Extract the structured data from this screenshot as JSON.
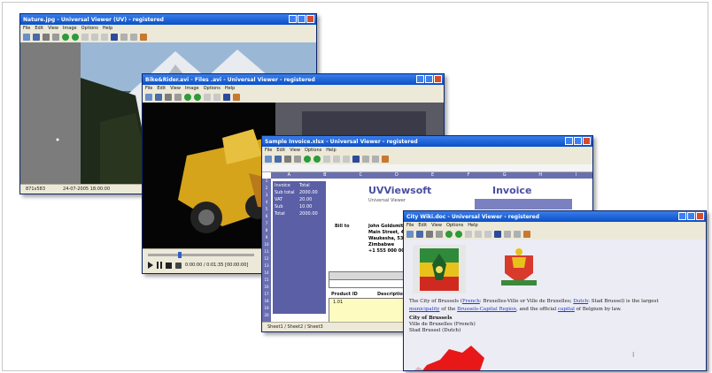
{
  "win1": {
    "title": "Nature.jpg - Universal Viewer (UV) - registered",
    "menu": [
      "File",
      "Edit",
      "View",
      "Image",
      "Options",
      "Help"
    ],
    "status": [
      "871x583",
      "24-07-2005 18:00:00"
    ]
  },
  "win2": {
    "title": "Bike&Rider.avi - Files .avi - Universal Viewer - registered",
    "menu": [
      "File",
      "Edit",
      "View",
      "Image",
      "Options",
      "Help"
    ],
    "status": "0:00:00 / 0:01:35 [00:00:00]"
  },
  "win3": {
    "title": "Sample Invoice.xlsx - Universal Viewer - registered",
    "menu": [
      "File",
      "Edit",
      "View",
      "Options",
      "Help"
    ],
    "company": "UVViewsoft",
    "company_sub": "Universal Viewer",
    "doc_label": "Invoice",
    "bill_to": "Bill to",
    "address": [
      "John Goldsmith",
      "Main Street, 45",
      "Waukesha, 53188",
      "Zimbabwe",
      "+1 555 000 0000"
    ],
    "col_headers": [
      "A",
      "B",
      "C",
      "D",
      "E",
      "F",
      "G",
      "H",
      "I"
    ],
    "row_numbers": [
      "1",
      "2",
      "3",
      "4",
      "5",
      "6",
      "7",
      "8",
      "9",
      "10",
      "11",
      "12",
      "13",
      "14",
      "15",
      "16",
      "17",
      "18",
      "19",
      "20"
    ],
    "left_values": [
      "Invoice",
      "Sub total",
      "VAT",
      "Sub",
      "Total",
      "",
      "",
      ""
    ],
    "left_nums": [
      "Total",
      "2000.00",
      "20.00",
      "10.00",
      "2000.00"
    ],
    "product_id": "Product ID",
    "description": "Description",
    "product_row": "1.01",
    "sheet_tabs": "Sheet1 / Sheet2 / Sheet3"
  },
  "win4": {
    "title": "City Wiki.doc - Universal Viewer - registered",
    "menu": [
      "File",
      "Edit",
      "View",
      "Options",
      "Help"
    ],
    "para_a": "The City of Brussels (",
    "french": "French",
    "para_b": ": Bruxelles-Ville or Ville de Bruxelles; ",
    "dutch": "Dutch",
    "para_c": ": Stad Brussel) is the largest",
    "municipality": "municipality",
    "para_d": " of the ",
    "region": "Brussels-Capital Region",
    "para_e": ", and the official ",
    "capital": "capital",
    "para_f": " of Belgium by law.",
    "line1": "City of Brussels",
    "line2": "Ville de Bruxelles (French)",
    "line3": "Stad Brussel (Dutch)"
  }
}
